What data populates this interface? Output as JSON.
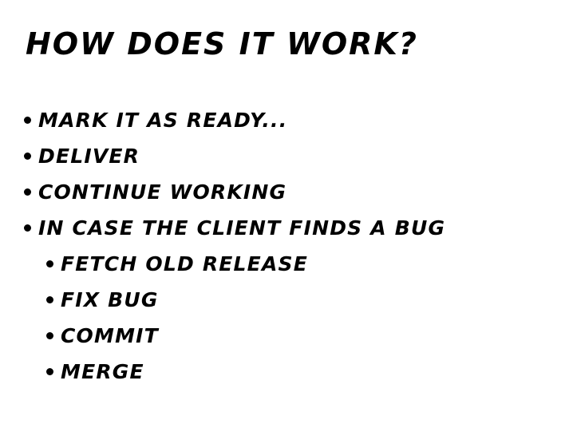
{
  "slide": {
    "title": "How does it work?",
    "bullets": [
      {
        "label": "Mark it as ready...",
        "level": 1
      },
      {
        "label": "Deliver",
        "level": 1
      },
      {
        "label": "Continue working",
        "level": 1
      },
      {
        "label": "In case the client finds a bug",
        "level": 1
      },
      {
        "label": "Fetch old release",
        "level": 2
      },
      {
        "label": "Fix bug",
        "level": 2
      },
      {
        "label": "Commit",
        "level": 2
      },
      {
        "label": "Merge",
        "level": 2
      }
    ]
  }
}
